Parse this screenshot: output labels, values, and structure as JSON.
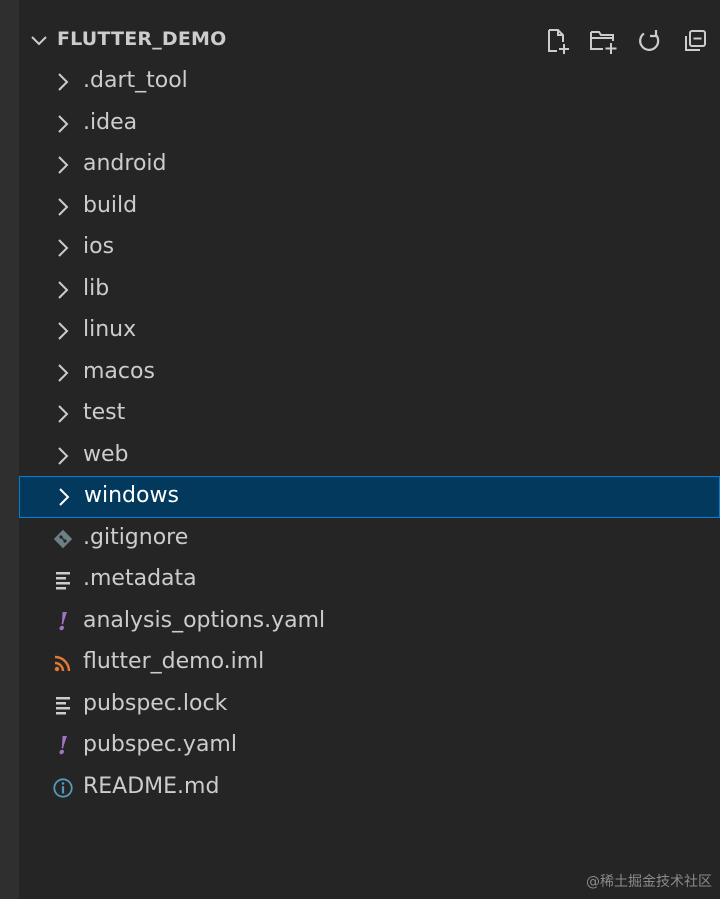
{
  "explorer": {
    "title": "FLUTTER_DEMO",
    "actions": [
      {
        "name": "new-file-button",
        "icon": "new-file-icon"
      },
      {
        "name": "new-folder-button",
        "icon": "new-folder-icon"
      },
      {
        "name": "refresh-explorer-button",
        "icon": "refresh-icon"
      },
      {
        "name": "collapse-folders-button",
        "icon": "collapse-all-icon"
      }
    ],
    "items": [
      {
        "label": ".dart_tool",
        "type": "folder",
        "icon": "chevron-right-icon"
      },
      {
        "label": ".idea",
        "type": "folder",
        "icon": "chevron-right-icon"
      },
      {
        "label": "android",
        "type": "folder",
        "icon": "chevron-right-icon"
      },
      {
        "label": "build",
        "type": "folder",
        "icon": "chevron-right-icon"
      },
      {
        "label": "ios",
        "type": "folder",
        "icon": "chevron-right-icon"
      },
      {
        "label": "lib",
        "type": "folder",
        "icon": "chevron-right-icon"
      },
      {
        "label": "linux",
        "type": "folder",
        "icon": "chevron-right-icon"
      },
      {
        "label": "macos",
        "type": "folder",
        "icon": "chevron-right-icon"
      },
      {
        "label": "test",
        "type": "folder",
        "icon": "chevron-right-icon"
      },
      {
        "label": "web",
        "type": "folder",
        "icon": "chevron-right-icon"
      },
      {
        "label": "windows",
        "type": "folder",
        "icon": "chevron-right-icon",
        "selected": true
      },
      {
        "label": ".gitignore",
        "type": "file",
        "icon": "git-icon"
      },
      {
        "label": ".metadata",
        "type": "file",
        "icon": "text-lines-icon"
      },
      {
        "label": "analysis_options.yaml",
        "type": "file",
        "icon": "yaml-icon"
      },
      {
        "label": "flutter_demo.iml",
        "type": "file",
        "icon": "rss-icon"
      },
      {
        "label": "pubspec.lock",
        "type": "file",
        "icon": "text-lines-icon"
      },
      {
        "label": "pubspec.yaml",
        "type": "file",
        "icon": "yaml-icon"
      },
      {
        "label": "README.md",
        "type": "file",
        "icon": "info-icon"
      }
    ]
  },
  "colors": {
    "background": "#252526",
    "selection": "#04395e",
    "selection_border": "#007fd4",
    "text": "#cccccc",
    "yaml": "#a074c4",
    "rss": "#e37933",
    "git": "#6d8086",
    "info": "#519aba"
  },
  "watermark": "@稀土掘金技术社区"
}
